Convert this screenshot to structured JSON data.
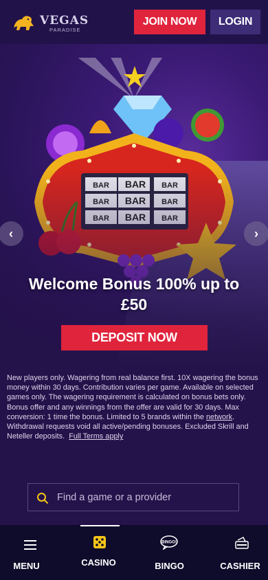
{
  "header": {
    "logo_title": "VEGAS",
    "logo_subtitle": "PARADISE",
    "join_label": "JOIN NOW",
    "login_label": "LOGIN"
  },
  "hero": {
    "headline": "Welcome Bonus 100% up to £50",
    "cta_label": "DEPOSIT NOW",
    "reel_symbols": [
      "BAR",
      "BAR",
      "BAR",
      "BAR",
      "BAR",
      "BAR",
      "BAR",
      "BAR",
      "BAR"
    ]
  },
  "terms": {
    "text_1": "New players only. Wagering from real balance first. 10X wagering the bonus money within 30 days. Contribution varies per game. Available on selected games only. The wagering requirement is calculated on bonus bets only. Bonus offer and any winnings from the offer are valid for 30 days. Max conversion: 1 time the bonus. Limited to 5 brands within the ",
    "network_link": "network",
    "text_2": ". Withdrawal requests void all active/pending bonuses. Excluded Skrill and Neteller deposits.",
    "full_terms_link": "Full Terms apply"
  },
  "search": {
    "placeholder": "Find a game or a provider"
  },
  "nav": {
    "items": [
      {
        "label": "MENU",
        "icon": "hamburger-icon"
      },
      {
        "label": "CASINO",
        "icon": "dice-icon",
        "active": true
      },
      {
        "label": "BINGO",
        "icon": "bingo-icon",
        "icon_text": "BINGO!"
      },
      {
        "label": "CASHIER",
        "icon": "cashier-icon"
      }
    ]
  },
  "colors": {
    "primary_red": "#e0243c",
    "login_purple": "#3d2d77",
    "background": "#24124a",
    "nav_bg": "#0f0b2a",
    "accent_gold": "#f5c518"
  }
}
